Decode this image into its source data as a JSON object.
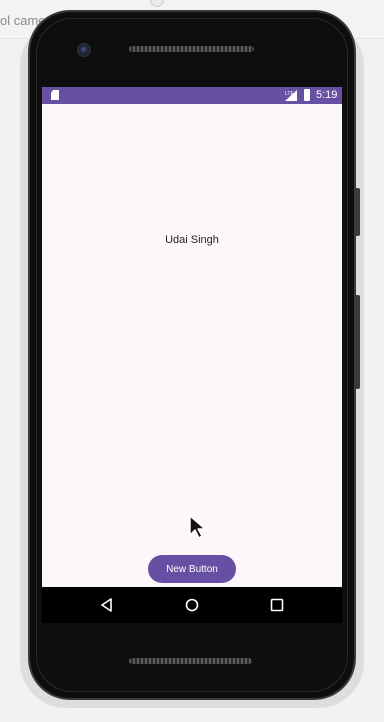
{
  "host": {
    "toolbar_text": "ol camera"
  },
  "status_bar": {
    "time": "5:19",
    "network": "LTE"
  },
  "app": {
    "name_label": "Udai Singh",
    "button_label": "New Button"
  },
  "colors": {
    "accent": "#6750a4",
    "screen_bg": "#fdf7fc"
  },
  "icons": [
    "sd-card-icon",
    "lte-signal-icon",
    "battery-icon",
    "back-icon",
    "home-icon",
    "recents-icon",
    "mouse-pointer-icon"
  ]
}
